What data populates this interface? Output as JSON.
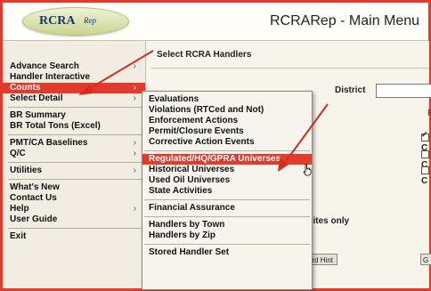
{
  "app": {
    "logo_text": "RCRA",
    "logo_sub": "Rep",
    "title": "RCRARep - Main Menu"
  },
  "sidebar": {
    "items": [
      {
        "label": "Advance Search",
        "chevron": "›"
      },
      {
        "label": "Handler Interactive",
        "chevron": ""
      },
      {
        "label": "Counts",
        "chevron": "›",
        "selected": true
      },
      {
        "label": "Select Detail",
        "chevron": "›"
      },
      {
        "label": "BR Summary",
        "chevron": ""
      },
      {
        "label": "BR Total Tons (Excel)",
        "chevron": ""
      },
      {
        "label": "PMT/CA Baselines",
        "chevron": "›"
      },
      {
        "label": "Q/C",
        "chevron": "›"
      },
      {
        "label": "Utilities",
        "chevron": "›"
      },
      {
        "label": "What's New",
        "chevron": ""
      },
      {
        "label": "Contact Us",
        "chevron": ""
      },
      {
        "label": "Help",
        "chevron": "›"
      },
      {
        "label": "User Guide",
        "chevron": ""
      },
      {
        "label": "Exit",
        "chevron": ""
      }
    ]
  },
  "main": {
    "section_title": "Select RCRA Handlers",
    "district_label": "District",
    "district_value": "",
    "right_label": "R",
    "checkboxes": [
      {
        "label": "C",
        "checked": true
      },
      {
        "label": "C",
        "checked": false
      },
      {
        "label": "C",
        "checked": false
      }
    ],
    "inactive_text": "ve sites only",
    "card_hint_label": "card Hint",
    "go_label": "G"
  },
  "counts_submenu": {
    "items": [
      {
        "label": "Evaluations"
      },
      {
        "label": "Violations (RTCed and Not)"
      },
      {
        "label": "Enforcement Actions"
      },
      {
        "label": "Permit/Closure Events"
      },
      {
        "label": "Corrective Action Events"
      },
      {
        "label": "Regulated/HQ/GPRA Universes",
        "selected": true
      },
      {
        "label": "Historical Universes"
      },
      {
        "label": "Used Oil Universes"
      },
      {
        "label": "State Activities"
      },
      {
        "label": "Financial Assurance"
      },
      {
        "label": "Handlers by Town"
      },
      {
        "label": "Handlers by Zip"
      },
      {
        "label": "Stored Handler Set"
      }
    ]
  },
  "colors": {
    "accent": "#e33a2b",
    "annotation_arrow": "#d62b1f"
  },
  "icons": {
    "cursor": "hand-pointer-icon",
    "chevron": "chevron-right-icon",
    "check": "check-icon"
  }
}
